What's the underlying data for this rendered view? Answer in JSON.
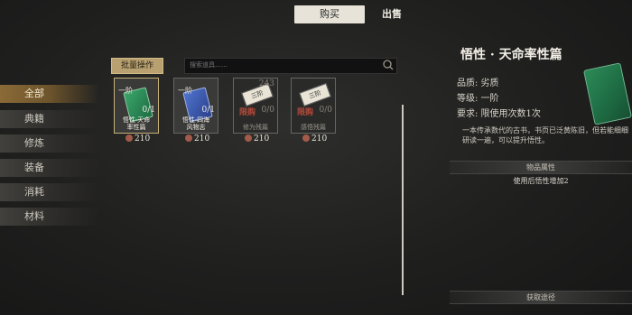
{
  "tabs": {
    "buy": "购买",
    "sell": "出售"
  },
  "sidebar": {
    "items": [
      {
        "label": "全部",
        "active": true
      },
      {
        "label": "典籍"
      },
      {
        "label": "修炼"
      },
      {
        "label": "装备"
      },
      {
        "label": "消耗"
      },
      {
        "label": "材料"
      }
    ]
  },
  "toolbar": {
    "batch_label": "批量操作",
    "search_placeholder": "搜索道具……"
  },
  "items": [
    {
      "grade": "一阶",
      "qty": "0/1",
      "name_l1": "悟性·天命",
      "name_l2": "率性篇",
      "price": "210",
      "color": "#2f9a5c"
    },
    {
      "grade": "一阶",
      "qty": "0/1",
      "name_l1": "悟性·四海",
      "name_l2": "风物志",
      "price": "210",
      "color": "#3a5bb0"
    },
    {
      "grade": "",
      "qty_top": "243",
      "qty": "0/0",
      "locked": "限购",
      "tag": "三阶",
      "name_l1": "修为残篇",
      "name_l2": "",
      "price": "210"
    },
    {
      "grade": "",
      "qty": "0/0",
      "locked": "限购",
      "tag": "三阶",
      "name_l1": "感悟残篇",
      "name_l2": "",
      "price": "210"
    }
  ],
  "detail": {
    "title": "悟性 · 天命率性篇",
    "quality": "品质: 劣质",
    "level": "等级: 一阶",
    "requirement": "要求: 限使用次数1次",
    "description": "一本传承数代的古书，书页已泛黄陈旧，但若能细细研读一遍，可以提升悟性。",
    "attr_header": "物品属性",
    "attr_effect": "使用后悟性增加2",
    "source_header": "获取途径"
  },
  "colors": {
    "accent": "#b8a070",
    "active_tab": "#e7e3d8"
  }
}
